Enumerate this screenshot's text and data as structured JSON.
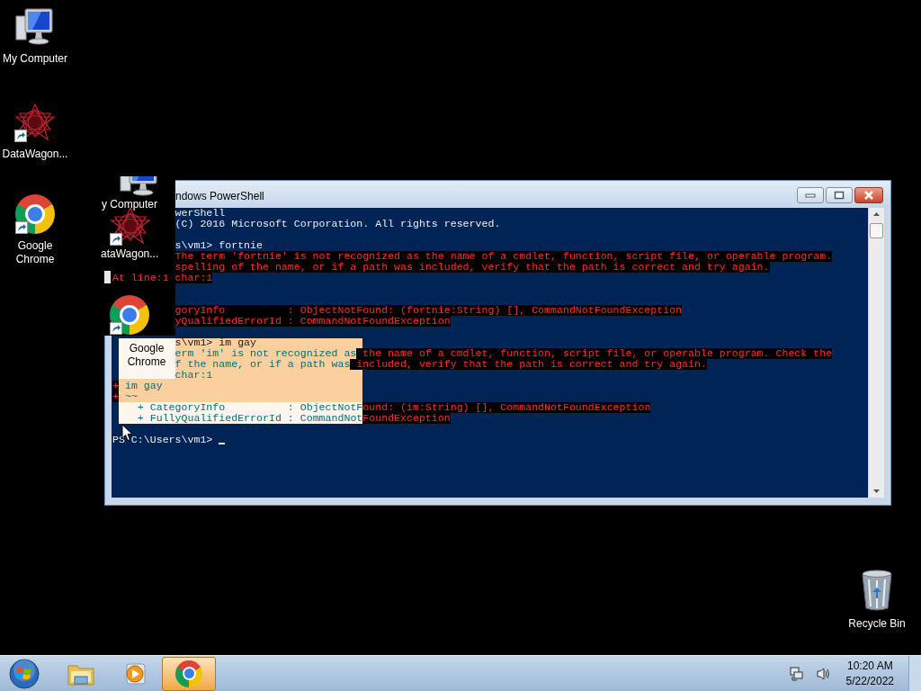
{
  "desktop_icons": [
    {
      "label": "My Computer",
      "kind": "computer",
      "shortcut": false
    },
    {
      "label": "DataWagon...",
      "kind": "star",
      "shortcut": true
    },
    {
      "label": "Google Chrome",
      "kind": "chrome",
      "shortcut": true
    }
  ],
  "recycle_bin": {
    "label": "Recycle Bin",
    "kind": "bin",
    "shortcut": false
  },
  "ghost_icons": [
    {
      "label": "y Computer",
      "kind": "computer",
      "shortcut": false
    },
    {
      "label": "ataWagon...",
      "kind": "star",
      "shortcut": true
    },
    {
      "label": "Google Chrome",
      "kind": "chrome",
      "shortcut": true
    }
  ],
  "window": {
    "title": "ndows PowerShell",
    "lines": [
      {
        "kind": "text",
        "clipped_left": true,
        "segments": [
          {
            "kind": "out",
            "text": "werShell"
          }
        ]
      },
      {
        "kind": "text",
        "clipped_left": true,
        "segments": [
          {
            "kind": "out",
            "text": "(C) 2016 Microsoft Corporation. All rights reserved."
          }
        ]
      },
      {
        "kind": "blank"
      },
      {
        "kind": "text",
        "clipped_left": true,
        "segments": [
          {
            "kind": "out",
            "text": "s\\vm1> fortnie"
          }
        ]
      },
      {
        "kind": "text",
        "clipped_left": true,
        "segments": [
          {
            "kind": "err",
            "text": "The term 'fortnie' is not recognized as the name of a cmdlet, function, script file, or operable program."
          }
        ]
      },
      {
        "kind": "text",
        "clipped_left": true,
        "segments": [
          {
            "kind": "err",
            "text": "spelling of the name, or if a path was included, verify that the path is correct and try again."
          }
        ]
      },
      {
        "kind": "text",
        "clipped_left": false,
        "segments": [
          {
            "kind": "err",
            "text": "At line:1 char:1"
          }
        ]
      },
      {
        "kind": "blank"
      },
      {
        "kind": "blank"
      },
      {
        "kind": "text",
        "clipped_left": true,
        "segments": [
          {
            "kind": "err",
            "text": "goryInfo          : ObjectNotFound: (fortnie:String) [], CommandNotFoundException"
          }
        ]
      },
      {
        "kind": "text",
        "clipped_left": true,
        "segments": [
          {
            "kind": "err",
            "text": "yQualifiedErrorId : CommandNotFoundException"
          }
        ]
      },
      {
        "kind": "blank"
      },
      {
        "kind": "text",
        "clipped_left": true,
        "segments": [
          {
            "kind": "sel",
            "text": "s\\vm1> im gay"
          }
        ]
      },
      {
        "kind": "text",
        "clipped_left": true,
        "segments": [
          {
            "kind": "hl",
            "text": "erm 'im' is not recognized as"
          },
          {
            "kind": "err",
            "text": " the name of a cmdlet, function, script file, or operable program. Check the"
          }
        ]
      },
      {
        "kind": "text",
        "clipped_left": true,
        "segments": [
          {
            "kind": "hl",
            "text": "f the name, or if a path was"
          },
          {
            "kind": "err",
            "text": " included, verify that the path is correct and try again."
          }
        ]
      },
      {
        "kind": "text",
        "clipped_left": true,
        "segments": [
          {
            "kind": "hl",
            "text": "char:1"
          }
        ]
      },
      {
        "kind": "text",
        "clipped_left": false,
        "segments": [
          {
            "kind": "err",
            "text": "+"
          },
          {
            "kind": "hl",
            "text": " im gay"
          }
        ]
      },
      {
        "kind": "text",
        "clipped_left": false,
        "segments": [
          {
            "kind": "err",
            "text": "+"
          },
          {
            "kind": "hl",
            "text": " ~~"
          }
        ]
      },
      {
        "kind": "text",
        "clipped_left": false,
        "segments": [
          {
            "kind": "hl",
            "text": "    + CategoryInfo          : ObjectNotF"
          },
          {
            "kind": "err",
            "text": "ound: (im:String) [], CommandNotFoundException"
          }
        ]
      },
      {
        "kind": "text",
        "clipped_left": false,
        "segments": [
          {
            "kind": "hl",
            "text": "    + FullyQualifiedErrorId : CommandNot"
          },
          {
            "kind": "err",
            "text": "FoundException"
          }
        ]
      },
      {
        "kind": "blank"
      },
      {
        "kind": "prompt",
        "clipped_left": false,
        "segments": [
          {
            "kind": "out",
            "text": "PS C:\\Users\\vm1> "
          }
        ]
      }
    ]
  },
  "taskbar": {
    "items": [
      {
        "kind": "explorer",
        "selected": false
      },
      {
        "kind": "media",
        "selected": false
      },
      {
        "kind": "chrome",
        "selected": true
      }
    ],
    "time": "10:20 AM",
    "date": "5/22/2022"
  }
}
